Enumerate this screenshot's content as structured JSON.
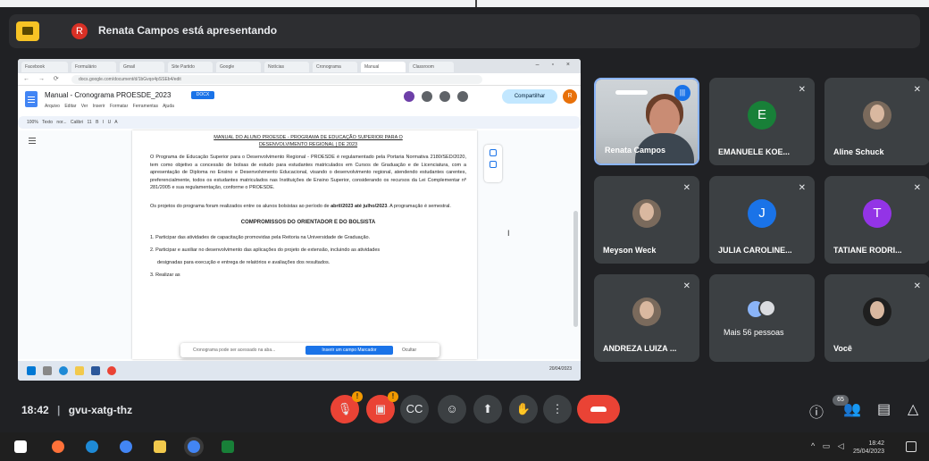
{
  "presenter_bar": {
    "avatar_letter": "R",
    "text": "Renata Campos está apresentando"
  },
  "shared_screen": {
    "browser_tabs": [
      "Facebook",
      "Formulário",
      "Gmail",
      "Site Partido",
      "Google",
      "Notícias",
      "Cronograma",
      "Manual",
      "Classroom"
    ],
    "address": "docs.google.com/document/d/1bGvqo4pSSEb4/edit",
    "doc_title": "Manual - Cronograma PROESDE_2023",
    "doc_badge": "DOCX",
    "doc_menus": "Arquivo Editar Ver Inserir Formatar Ferramentas Ajuda",
    "share_label": "Compartilhar",
    "user_letter": "R",
    "toolbar_text": "100% Texto nor... Calibri 11 B I U A",
    "page": {
      "heading_line1": "MANUAL DO ALUNO PROESDE - PROGRAMA DE EDUCAÇÃO SUPERIOR PARA O",
      "heading_line2": "DESENVOLVIMENTO REGIONAL | DE 2023",
      "para1": "O Programa de Educação Superior para o Desenvolvimento Regional - PROESDE é regulamentado pela Portaria Normativa 2180/SED/2020, tem como objetivo a concessão de bolsas de estudo para estudantes matriculados em Cursos de Graduação e de Licenciatura, com a apresentação de Diploma no Ensino e Desenvolvimento Educacional, visando o desenvolvimento regional, atendendo estudantes carentes, preferencialmente, todos os estudantes matriculados nas Instituições de Ensino Superior, considerando os recursos da Lei Complementar nº 281/2005 e sua regulamentação, conforme o PROESDE.",
      "para2_start": "Os projetos do programa foram realizados entre os alunos bolsistas ao período de",
      "para2_bold": "abril/2023 até julho/2023",
      "para2_end": ". A programação é semestral.",
      "section": "COMPROMISSOS DO ORIENTADOR E DO BOLSISTA",
      "item1": "1. Participar das atividades de capacitação promovidas pela Reitoria na Universidade de Graduação.",
      "item2": "2. Participar e auxiliar no desenvolvimento das aplicações do projeto de extensão, incluindo as atividades",
      "item2b": "designadas para execução e entrega de relatórios e avaliações dos resultados.",
      "item3": "3. Realizar as"
    },
    "popup_text": "Cronograma pode ser acessado na aba...",
    "popup_button": "Inserir um campo Marcador",
    "popup_close": "Ocultar",
    "win_tray": "20/04/2023"
  },
  "participants": [
    {
      "name": "Renata Campos",
      "type": "camera",
      "speaking": true
    },
    {
      "name": "EMANUELE KOE...",
      "type": "letter",
      "letter": "E",
      "color": "#188038",
      "muted": true
    },
    {
      "name": "Aline Schuck",
      "type": "photo",
      "muted": true
    },
    {
      "name": "Meyson Weck",
      "type": "photo",
      "muted": true
    },
    {
      "name": "JULIA CAROLINE...",
      "type": "letter",
      "letter": "J",
      "color": "#1a73e8",
      "muted": true
    },
    {
      "name": "TATIANE RODRI...",
      "type": "letter",
      "letter": "T",
      "color": "#9334e6",
      "muted": true
    },
    {
      "name": "ANDREZA LUIZA ...",
      "type": "photo",
      "muted": true
    },
    {
      "name": "Mais 56 pessoas",
      "type": "more"
    },
    {
      "name": "Você",
      "type": "photo",
      "muted": true
    }
  ],
  "meeting": {
    "time": "18:42",
    "code": "gvu-xatg-thz",
    "separator": "|",
    "people_count": "65"
  },
  "os": {
    "time": "18:42",
    "date": "25/04/2023"
  },
  "colors": {
    "accent": "#8ab4f8",
    "hangup": "#ea4335",
    "warning": "#f29900"
  }
}
